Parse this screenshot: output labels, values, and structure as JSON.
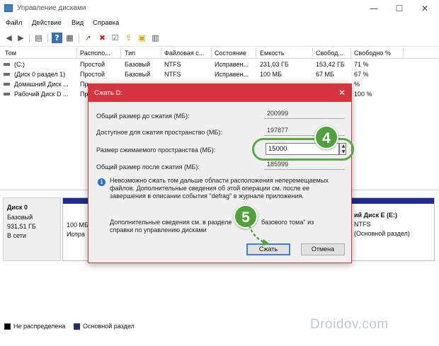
{
  "window": {
    "title": "Управление дисками",
    "minimize": "—",
    "maximize": "☐",
    "close": "✕"
  },
  "menu": [
    "Файл",
    "Действие",
    "Вид",
    "Справка"
  ],
  "toolbar_icons": [
    "back-icon",
    "forward-icon",
    "properties-icon",
    "help-icon",
    "list-icon",
    "connect-icon",
    "delete-icon",
    "check-icon",
    "import-icon",
    "folder-icon",
    "view-icon"
  ],
  "table": {
    "headers": [
      "Том",
      "Располо...",
      "Тип",
      "Файловая с...",
      "Состояние",
      "Емкость",
      "Свобод...",
      "Свободно %"
    ],
    "rows": [
      [
        "(C:)",
        "Простой",
        "Базовый",
        "NTFS",
        "Исправен...",
        "231,03 ГБ",
        "153,42 ГБ",
        "71 %"
      ],
      [
        "(Диск 0 раздел 1)",
        "Простой",
        "Базовый",
        "NTFS",
        "Исправен...",
        "100 МБ",
        "67 МБ",
        "67 %"
      ],
      [
        "Домашний Диск ...",
        "Пр",
        "",
        "",
        "",
        "",
        "",
        "%"
      ],
      [
        "Рабочий Диск D ...",
        "Пр",
        "",
        "",
        "",
        "",
        "",
        "100 %"
      ]
    ]
  },
  "disk": {
    "name": "Диск 0",
    "type": "Базовый",
    "size": "931,51 ГБ",
    "status": "В сети",
    "part1_line1": "100 МБ",
    "part1_line2": "Испра",
    "part2_title": "ий Диск E (E:)",
    "part2_fs": "NTFS",
    "part2_status": "(Основной раздел)"
  },
  "legend": {
    "unallocated": "Не распределена",
    "primary": "Основной раздел"
  },
  "watermark": "Droidov.com",
  "dialog": {
    "title": "Сжать D:",
    "label_total_before": "Общий размер до сжатия (МБ):",
    "value_total_before": "200999",
    "label_available": "Доступное для сжатия пространство (МБ):",
    "value_available": "197877",
    "label_shrink_size": "Размер сжимаемого пространства (МБ):",
    "value_shrink_size": "15000",
    "label_total_after": "Общий размер после сжатия (МБ):",
    "value_total_after": "185999",
    "info_text_1": "Невозможно сжать том дальше области расположения неперемещаемых",
    "info_text_2": "файлов. Дополнительные сведения об этой операции см. после ее",
    "info_text_3": "завершения в описании события \"defrag\" в журнале приложения.",
    "help_text_1a": "Дополнительные сведения см. в разделе",
    "help_text_1b": "базового тома\" из",
    "help_text_2": "справки по управлению дисками",
    "shrink_button": "Сжать",
    "cancel_button": "Отмена"
  },
  "annotations": {
    "step4": "4",
    "step5": "5",
    "accent": "#4fa23a"
  },
  "colors": {
    "dialog_title": "#d6353f",
    "primary_partition": "#1c2f8a",
    "default_button": "#3c7fd4"
  }
}
